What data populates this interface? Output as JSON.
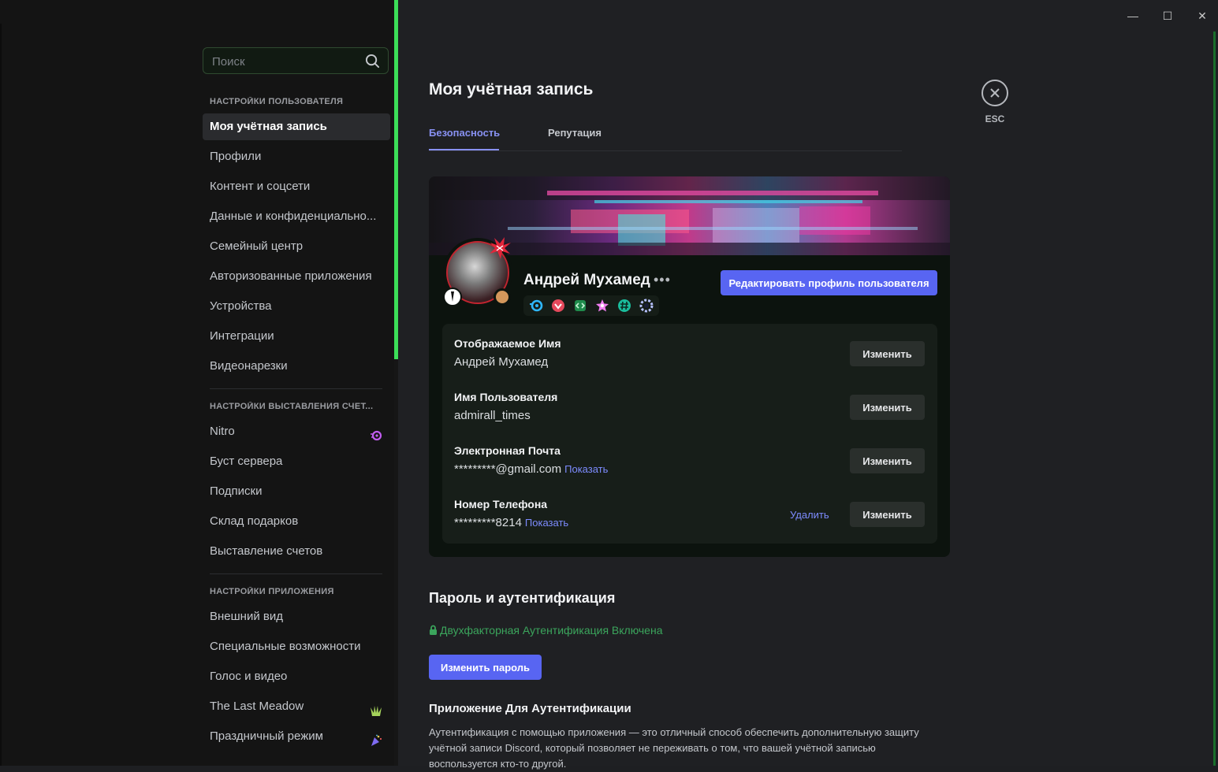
{
  "sidebar": {
    "search_placeholder": "Поиск",
    "categories": {
      "user": "Настройки пользователя",
      "billing": "Настройки выставления счет...",
      "app": "Настройки приложения"
    },
    "items": [
      {
        "label": "Моя учётная запись"
      },
      {
        "label": "Профили"
      },
      {
        "label": "Контент и соцсети"
      },
      {
        "label": "Данные и конфиденциально..."
      },
      {
        "label": "Семейный центр"
      },
      {
        "label": "Авторизованные приложения"
      },
      {
        "label": "Устройства"
      },
      {
        "label": "Интеграции"
      },
      {
        "label": "Видеонарезки"
      },
      {
        "label": "Nitro"
      },
      {
        "label": "Буст сервера"
      },
      {
        "label": "Подписки"
      },
      {
        "label": "Склад подарков"
      },
      {
        "label": "Выставление счетов"
      },
      {
        "label": "Внешний вид"
      },
      {
        "label": "Специальные возможности"
      },
      {
        "label": "Голос и видео"
      },
      {
        "label": "The Last Meadow"
      },
      {
        "label": "Праздничный режим"
      }
    ]
  },
  "window_controls": {
    "minimize": "—",
    "maximize": "☐",
    "close": "✕"
  },
  "main": {
    "title": "Моя учётная запись",
    "esc_label": "ESC",
    "tabs": [
      {
        "label": "Безопасность",
        "selected": true
      },
      {
        "label": "Репутация",
        "selected": false
      }
    ]
  },
  "profile": {
    "display_name": "Андрей Мухамед",
    "more": "•••",
    "status_color": "#d3975b",
    "edit_button": "Редактировать профиль пользователя",
    "badges": [
      "nitro-badge-icon",
      "heart-badge-icon",
      "dev-badge-icon",
      "star-badge-icon",
      "hashtag-badge-icon",
      "gear-badge-icon"
    ]
  },
  "fields": [
    {
      "label": "Отображаемое Имя",
      "value": "Андрей Мухамед",
      "button": "Изменить"
    },
    {
      "label": "Имя Пользователя",
      "value": "admirall_times",
      "button": "Изменить"
    },
    {
      "label": "Электронная Почта",
      "value": "*********@gmail.com",
      "show": "Показать",
      "button": "Изменить"
    },
    {
      "label": "Номер Телефона",
      "value": "*********8214",
      "show": "Показать",
      "delete": "Удалить",
      "button": "Изменить"
    }
  ],
  "security": {
    "title": "Пароль и аутентификация",
    "tfa_status": "Двухфакторная Аутентификация Включена",
    "change_password": "Изменить пароль",
    "auth_app_title": "Приложение Для Аутентификации",
    "auth_app_desc": "Аутентификация с помощью приложения — это отличный способ обеспечить дополнительную защиту учётной записи Discord, который позволяет не переживать о том, что вашей учётной записью воспользуется кто-то другой."
  },
  "colors": {
    "accent": "#5865f2",
    "link": "#7d8cff",
    "success": "#3ba55c",
    "scroll_accent": "#3cde58"
  }
}
